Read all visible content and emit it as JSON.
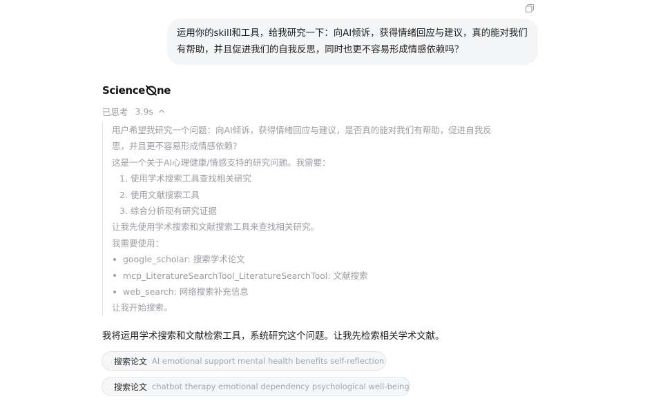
{
  "user_message": {
    "line1": "运用你的skill和工具，给我研究一下：向AI倾诉，获得情绪回应与建议，真的能对我们",
    "line2": "有帮助，并且促进我们的自我反思，同时也更不容易形成情感依赖吗？"
  },
  "assistant": {
    "brand": {
      "left": "Science",
      "right": "ne"
    },
    "thinking": {
      "label": "已思考",
      "duration": "3.9s",
      "lines": [
        "用户希望我研究一个问题：向AI倾诉，获得情绪回应与建议，是否真的能对我们有帮助，促进自我反",
        "思，并且更不容易形成情感依赖？",
        "这是一个关于AI心理健康/情感支持的研究问题。我需要：",
        "1. 使用学术搜索工具查找相关研究",
        "2. 使用文献搜索工具",
        "3. 综合分析现有研究证据",
        "让我先使用学术搜索和文献搜索工具来查找相关研究。",
        "我需要使用：",
        "google_scholar: 搜索学术论文",
        "mcp_LiteratureSearchTool_LiteratureSearchTool: 文献搜索",
        "web_search: 网络搜索补充信息",
        "让我开始搜索。"
      ]
    },
    "answer": "我将运用学术搜索和文献检索工具，系统研究这个问题。让我先检索相关学术文献。",
    "searches": [
      {
        "label": "搜索论文",
        "query": "AI emotional support mental health benefits self-reflection"
      },
      {
        "label": "搜索论文",
        "query": "chatbot therapy emotional dependency psychological well-being"
      }
    ]
  },
  "icons": {
    "copy": "copy-icon",
    "chevron": "chevron-up-icon",
    "search": "search-icon"
  },
  "colors": {
    "bubble_bg": "#f4f5f6",
    "muted_text": "#9a9da3",
    "chip_bg": "#f6f7f8"
  }
}
